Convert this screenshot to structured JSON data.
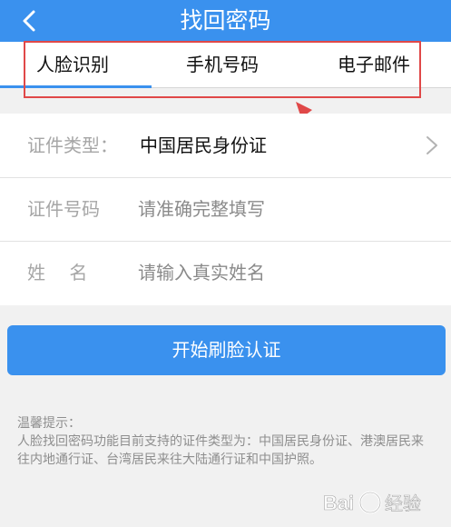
{
  "header": {
    "title": "找回密码",
    "back_icon": "chevron-left-icon"
  },
  "tabs": [
    {
      "label": "人脸识别",
      "active": true
    },
    {
      "label": "手机号码",
      "active": false
    },
    {
      "label": "电子邮件",
      "active": false
    }
  ],
  "form": {
    "id_type": {
      "label": "证件类型：",
      "value": "中国居民身份证",
      "icon": "chevron-right-icon"
    },
    "id_number": {
      "label": "证件号码",
      "placeholder": "请准确完整填写"
    },
    "name": {
      "label": "姓　 名",
      "placeholder": "请输入真实姓名"
    }
  },
  "start_button": {
    "label": "开始刷脸认证"
  },
  "tips": {
    "title": "温馨提示：",
    "text": "人脸找回密码功能目前支持的证件类型为：中国居民身份证、港澳居民来往内地通行证、台湾居民来往大陆通行证和中国护照。"
  },
  "watermark": {
    "text": "Bai 经验"
  },
  "colors": {
    "primary": "#3a91ee",
    "annotation": "#e04848"
  }
}
